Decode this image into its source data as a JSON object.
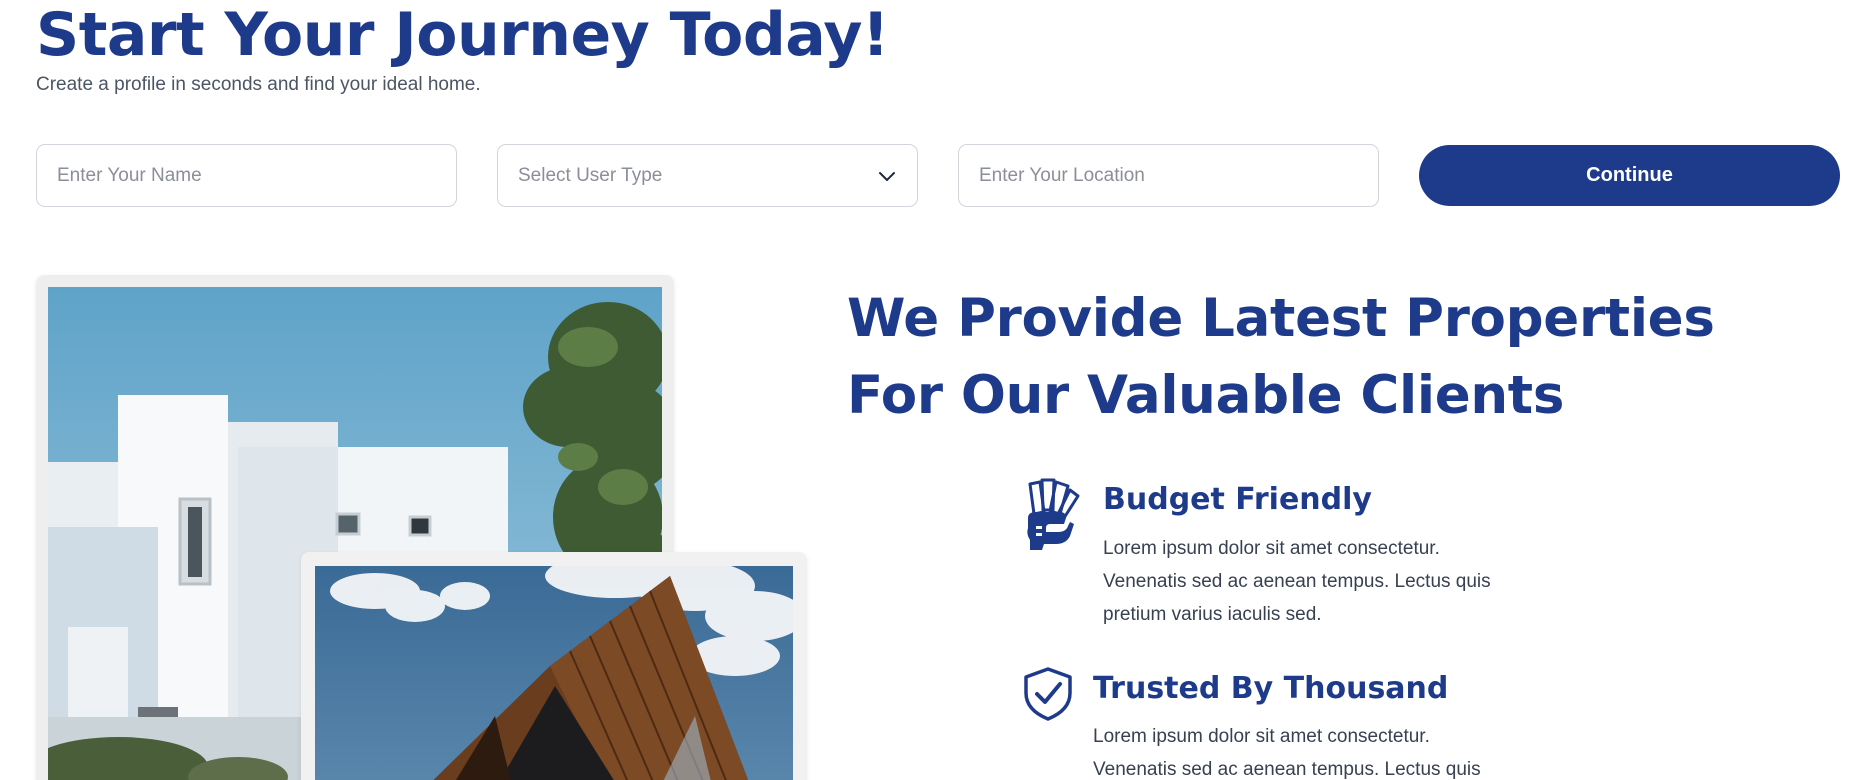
{
  "hero": {
    "title": "Start Your Journey Today!",
    "subtitle": "Create a profile in seconds and find your ideal home."
  },
  "form": {
    "name_placeholder": "Enter Your Name",
    "user_type_placeholder": "Select User Type",
    "location_placeholder": "Enter Your Location",
    "continue_label": "Continue"
  },
  "about": {
    "title_line1": "We Provide Latest Properties",
    "title_line2": "For Our Valuable Clients",
    "features": [
      {
        "icon": "money-hand-icon",
        "title": "Budget Friendly",
        "description": "Lorem ipsum dolor sit amet consectetur. Venenatis sed ac aenean tempus. Lectus quis pretium varius iaculis sed."
      },
      {
        "icon": "shield-check-icon",
        "title": "Trusted By Thousand",
        "description": "Lorem ipsum dolor sit amet consectetur. Venenatis sed ac aenean tempus. Lectus quis"
      }
    ]
  },
  "colors": {
    "brand": "#1e3a8a",
    "text_muted": "#4b5563",
    "border": "#d1d5db"
  }
}
